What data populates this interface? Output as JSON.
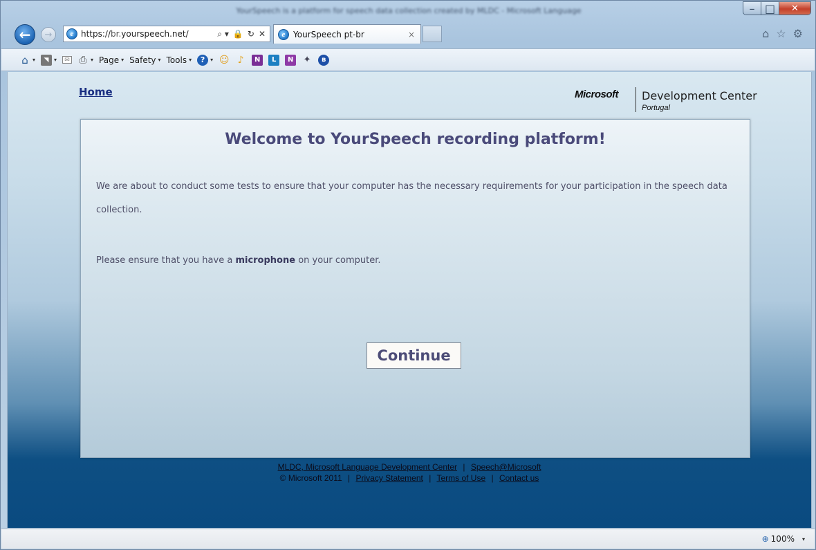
{
  "window": {
    "title": "YourSpeech is a platform for speech data collection created by MLDC - Microsoft Language",
    "controls": {
      "minimize": "–",
      "maximize": "□",
      "close": "✕"
    }
  },
  "nav": {
    "back_icon": "←",
    "forward_icon": "→",
    "url_host_prefix": "https://",
    "url_host_dim": "br.",
    "url_host_main": "yourspeech.net/",
    "address_icons": [
      "⌕ ▾",
      "🔒",
      "↻",
      "✕"
    ],
    "tab_title": "YourSpeech pt-br",
    "tab_close": "×",
    "right_icons": [
      "⌂",
      "☆",
      "⚙"
    ]
  },
  "command_bar": {
    "page_label": "Page",
    "safety_label": "Safety",
    "tools_label": "Tools",
    "dropdown_caret": "▾",
    "ie_glyph": "e",
    "help_glyph": "?",
    "onenote_glyph": "N",
    "lync_glyph": "L",
    "bluetooth_glyph": "ʙ"
  },
  "page": {
    "home_link": "Home",
    "logo": {
      "microsoft": "Microsoft",
      "development_center": "Development Center",
      "portugal": "Portugal"
    },
    "title": "Welcome to YourSpeech recording platform!",
    "paragraph1": "We are about to conduct some tests to ensure that your computer has the necessary requirements for your participation in the speech data collection.",
    "paragraph2_prefix": "Please ensure that you have a ",
    "paragraph2_bold": "microphone",
    "paragraph2_suffix": " on your computer.",
    "continue_button": "Continue"
  },
  "footer": {
    "line1_link1": "MLDC, Microsoft Language Development Center",
    "line1_link2": "Speech@Microsoft",
    "copyright": "© Microsoft 2011",
    "privacy": "Privacy Statement",
    "terms": "Terms of Use",
    "contact": "Contact us",
    "separator": "|"
  },
  "status_bar": {
    "zoom": "100%",
    "zoom_caret": "▾"
  },
  "colors": {
    "title_text": "#4a4a7a",
    "home_link": "#1a2f82",
    "content_top": "#d9e8f1",
    "content_bottom": "#0a4a80"
  }
}
